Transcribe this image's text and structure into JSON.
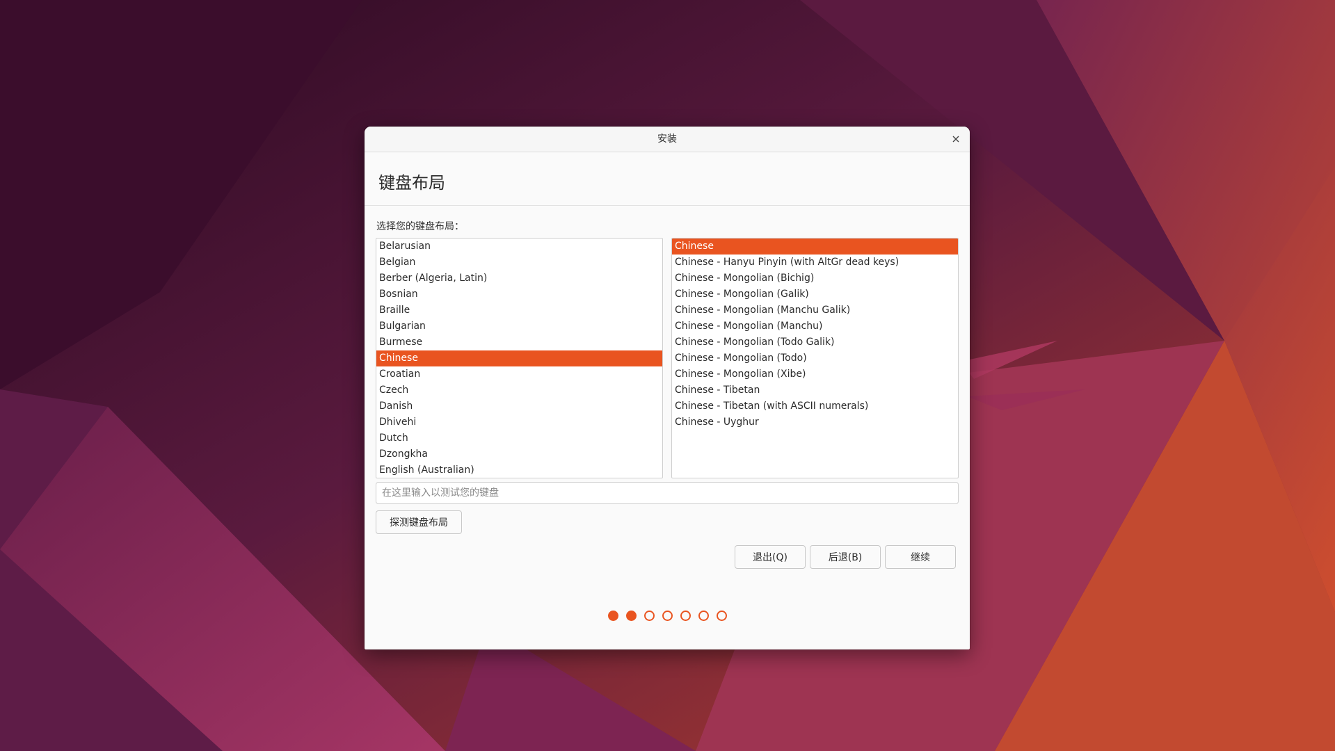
{
  "window": {
    "title": "安装"
  },
  "page": {
    "title": "键盘布局",
    "prompt": "选择您的键盘布局："
  },
  "layouts": {
    "selected": "Chinese",
    "items": [
      "Belarusian",
      "Belgian",
      "Berber (Algeria, Latin)",
      "Bosnian",
      "Braille",
      "Bulgarian",
      "Burmese",
      "Chinese",
      "Croatian",
      "Czech",
      "Danish",
      "Dhivehi",
      "Dutch",
      "Dzongkha",
      "English (Australian)"
    ]
  },
  "variants": {
    "selected": "Chinese",
    "items": [
      "Chinese",
      "Chinese - Hanyu Pinyin (with AltGr dead keys)",
      "Chinese - Mongolian (Bichig)",
      "Chinese - Mongolian (Galik)",
      "Chinese - Mongolian (Manchu Galik)",
      "Chinese - Mongolian (Manchu)",
      "Chinese - Mongolian (Todo Galik)",
      "Chinese - Mongolian (Todo)",
      "Chinese - Mongolian (Xibe)",
      "Chinese - Tibetan",
      "Chinese - Tibetan (with ASCII numerals)",
      "Chinese - Uyghur"
    ]
  },
  "test_input": {
    "placeholder": "在这里输入以测试您的键盘",
    "value": ""
  },
  "buttons": {
    "detect": "探测键盘布局",
    "quit": "退出(Q)",
    "back": "后退(B)",
    "continue": "继续"
  },
  "progress": {
    "total_steps": 7,
    "completed_steps": 2
  },
  "icons": {
    "close": "close-icon"
  },
  "colors": {
    "accent": "#e95420",
    "window_bg": "#fafafa"
  }
}
